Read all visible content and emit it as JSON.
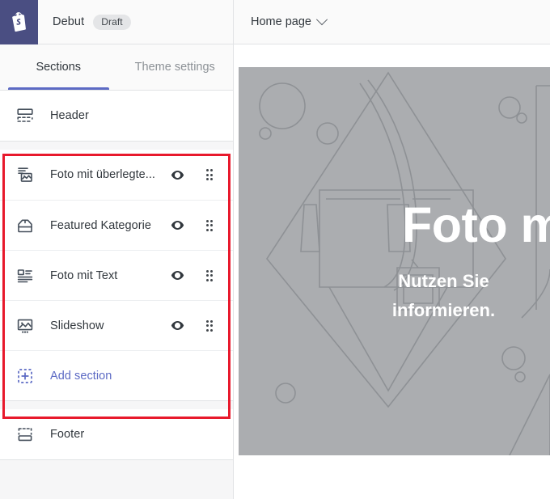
{
  "topbar": {
    "logo_icon": "shopify-bag-icon",
    "theme_name": "Debut",
    "status_badge": "Draft",
    "page_picker_label": "Home page",
    "page_picker_chevron": "chevron-down-icon"
  },
  "sidebar": {
    "tabs": [
      {
        "label": "Sections",
        "active": true
      },
      {
        "label": "Theme settings",
        "active": false
      }
    ],
    "groups": [
      {
        "name": "header-group",
        "rows": [
          {
            "label": "Header",
            "icon": "header-layout-icon",
            "has_eye": false,
            "has_drag": false,
            "is_add": false
          }
        ]
      },
      {
        "name": "body-group",
        "rows": [
          {
            "label": "Foto mit überlegte...",
            "icon": "image-with-text-overlay-icon",
            "has_eye": true,
            "has_drag": true,
            "is_add": false
          },
          {
            "label": "Featured Kategorie",
            "icon": "collection-tag-icon",
            "has_eye": true,
            "has_drag": true,
            "is_add": false
          },
          {
            "label": "Foto mit Text",
            "icon": "image-with-text-icon",
            "has_eye": true,
            "has_drag": true,
            "is_add": false
          },
          {
            "label": "Slideshow",
            "icon": "slideshow-icon",
            "has_eye": true,
            "has_drag": true,
            "is_add": false
          },
          {
            "label": "Add section",
            "icon": "add-section-plus-icon",
            "has_eye": false,
            "has_drag": false,
            "is_add": true
          }
        ]
      },
      {
        "name": "footer-group",
        "rows": [
          {
            "label": "Footer",
            "icon": "footer-layout-icon",
            "has_eye": false,
            "has_drag": false,
            "is_add": false
          }
        ]
      }
    ],
    "eye_icon": "eye-visibility-icon",
    "drag_icon": "drag-handle-icon"
  },
  "preview": {
    "placeholder_image": "handbag-lineart-placeholder-icon",
    "overlay_heading": "Foto m",
    "overlay_subline_1": "Nutzen Sie",
    "overlay_subline_2": "informieren."
  },
  "annotation": {
    "highlight_box": "red-highlight-rectangle"
  },
  "colors": {
    "brand_purple": "#5c6ac4",
    "logo_tile": "#4a4e82",
    "highlight_red": "#e8192c",
    "placeholder_gray": "#abadb0",
    "sidebar_bg": "#f6f6f7",
    "text_primary": "#31373d",
    "text_muted": "#8c9196"
  }
}
